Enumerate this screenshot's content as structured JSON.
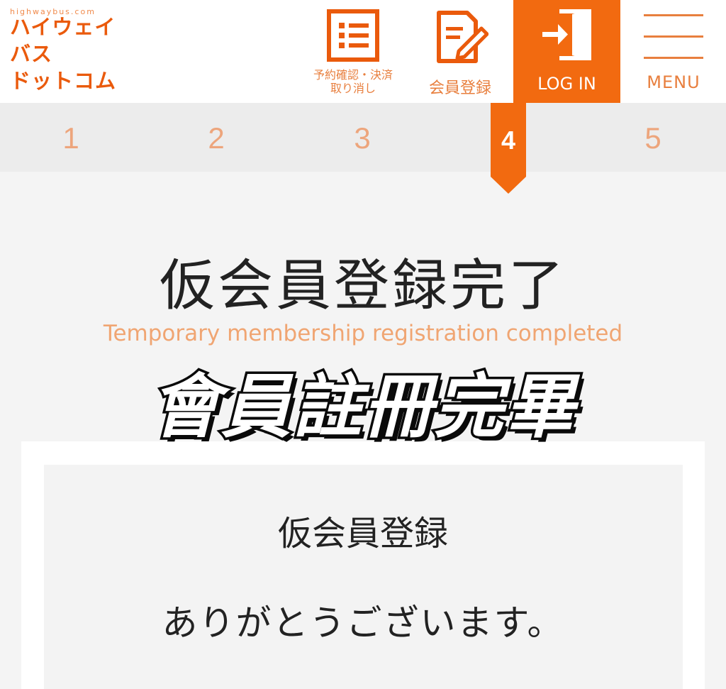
{
  "header": {
    "logo": {
      "domain": "highwaybus.com",
      "lines": [
        "ハイウェイ",
        "バス",
        "ドットコム"
      ]
    },
    "nav": {
      "reserve": {
        "line1": "予約確認・決済",
        "line2": "取り消し"
      },
      "signup": {
        "label": "会員登録"
      },
      "login": {
        "label": "LOG IN"
      },
      "menu": {
        "label": "MENU"
      }
    }
  },
  "steps": {
    "items": [
      "1",
      "2",
      "3",
      "4",
      "5"
    ],
    "active_index": 3
  },
  "title": {
    "jp": "仮会員登録完了",
    "en": "Temporary membership registration completed"
  },
  "overlay_caption": "會員註冊完畢",
  "card": {
    "heading": "仮会員登録",
    "text": "ありがとうございます。"
  },
  "colors": {
    "brand_orange": "#f26a10",
    "accent_light": "#f0a572",
    "step_inactive": "#eda57c"
  }
}
